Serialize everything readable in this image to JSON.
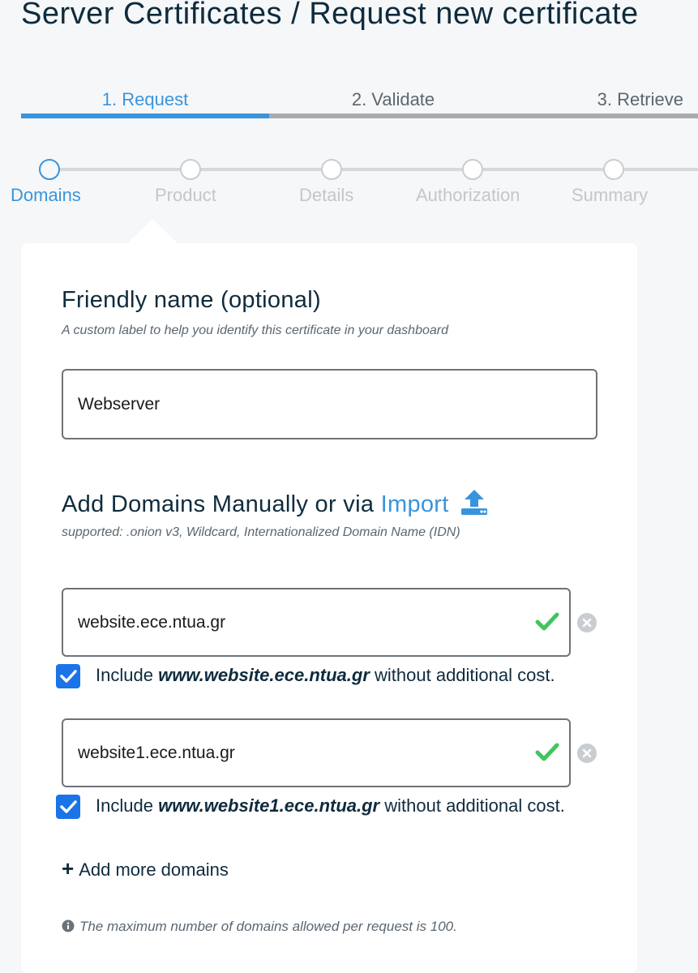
{
  "page": {
    "title": "Server Certificates / Request new certificate"
  },
  "step_tabs": [
    {
      "label": "1. Request",
      "active": true
    },
    {
      "label": "2. Validate",
      "active": false
    },
    {
      "label": "3. Retrieve",
      "active": false
    }
  ],
  "stepper": [
    {
      "label": "Domains",
      "active": true
    },
    {
      "label": "Product",
      "active": false
    },
    {
      "label": "Details",
      "active": false
    },
    {
      "label": "Authorization",
      "active": false
    },
    {
      "label": "Summary",
      "active": false
    }
  ],
  "friendly_name": {
    "heading": "Friendly name (optional)",
    "hint": "A custom label to help you identify this certificate in your dashboard",
    "value": "Webserver"
  },
  "domains": {
    "heading_prefix": "Add Domains Manually or via",
    "import_label": "Import",
    "hint": "supported: .onion v3, Wildcard, Internationalized Domain Name (IDN)",
    "entries": [
      {
        "value": "website.ece.ntua.gr",
        "include_checked": true,
        "include_prefix": "Include",
        "include_www": "www.website.ece.ntua.gr",
        "include_suffix": "without additional cost."
      },
      {
        "value": "website1.ece.ntua.gr",
        "include_checked": true,
        "include_prefix": "Include",
        "include_www": "www.website1.ece.ntua.gr",
        "include_suffix": "without additional cost."
      }
    ],
    "add_more_label": "Add more domains",
    "max_note": "The maximum number of domains allowed per request is 100."
  },
  "colors": {
    "accent": "#3a94dc",
    "checkbox": "#1b73e8",
    "valid": "#3fc65d",
    "text": "#0f2b3d"
  }
}
